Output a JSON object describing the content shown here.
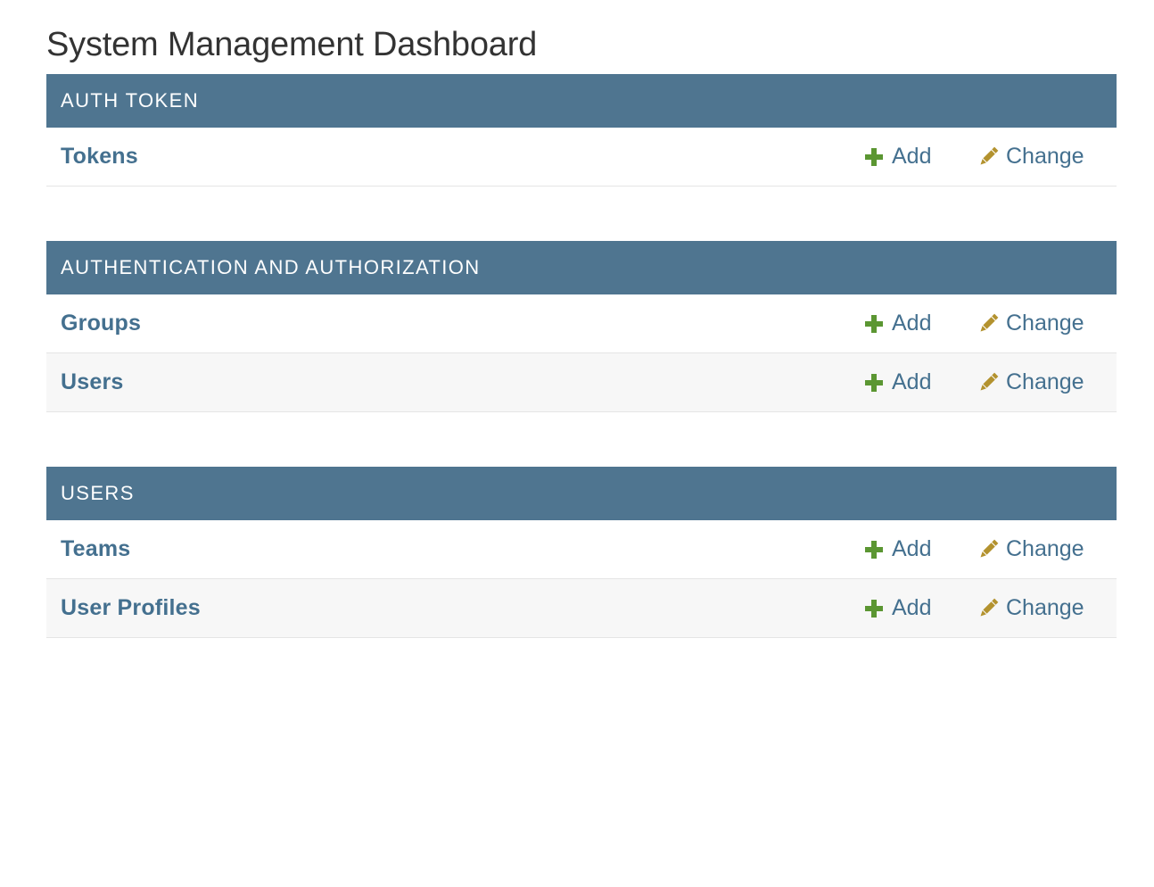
{
  "page": {
    "title": "System Management Dashboard"
  },
  "colors": {
    "header_bg": "#4f7590",
    "link": "#44708f",
    "add_icon": "#5b9632",
    "change_icon": "#b3922e"
  },
  "modules": [
    {
      "header": "AUTH TOKEN",
      "models": [
        {
          "name": "Tokens",
          "add_label": "Add",
          "change_label": "Change"
        }
      ]
    },
    {
      "header": "AUTHENTICATION AND AUTHORIZATION",
      "models": [
        {
          "name": "Groups",
          "add_label": "Add",
          "change_label": "Change"
        },
        {
          "name": "Users",
          "add_label": "Add",
          "change_label": "Change"
        }
      ]
    },
    {
      "header": "USERS",
      "models": [
        {
          "name": "Teams",
          "add_label": "Add",
          "change_label": "Change"
        },
        {
          "name": "User Profiles",
          "add_label": "Add",
          "change_label": "Change"
        }
      ]
    }
  ],
  "icons": {
    "add": "plus-icon",
    "change": "pencil-icon"
  }
}
